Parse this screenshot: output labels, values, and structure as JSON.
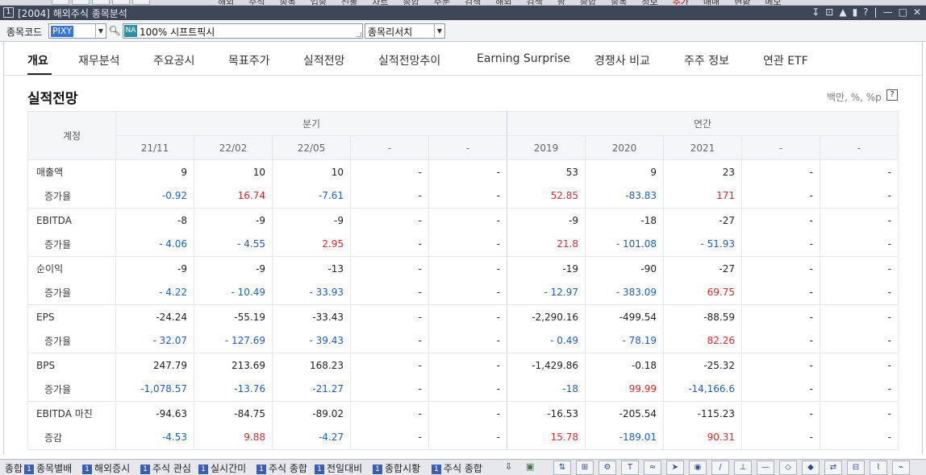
{
  "title_bar": {
    "text": "[2004] 해외주식 종목분석",
    "controls": [
      "↧",
      "⊡",
      "▲",
      "▮",
      "?",
      "|",
      "—",
      "□",
      "✕"
    ]
  },
  "top_menu": [
    "해외",
    "주식",
    "종목",
    "업종",
    "선물",
    "차트",
    "종합",
    "주문",
    "검색",
    "해외",
    "검색",
    "팜",
    "종합",
    "종목",
    "정보",
    "추가",
    "매매",
    "현황",
    "메모"
  ],
  "code_bar": {
    "label": "종목코드",
    "code_value": "PIXY",
    "name_badge": "NA",
    "name_value": "100% 시프트픽시",
    "finder_label": "종목리서치"
  },
  "tabs": [
    "개요",
    "재무분석",
    "주요공시",
    "목표주가",
    "실적전망",
    "실적전망추이",
    "Earning Surprise",
    "경쟁사 비교",
    "주주 정보",
    "연관 ETF"
  ],
  "section": {
    "title": "실적전망",
    "unit": "백만, %, %p",
    "help": "?"
  },
  "table": {
    "account_header": "계정",
    "group_quarterly": "분기",
    "group_annual": "연간",
    "columns": [
      "21/11",
      "22/02",
      "22/05",
      "-",
      "-",
      "2019",
      "2020",
      "2021",
      "-",
      "-"
    ],
    "rows": [
      {
        "label": "매출액",
        "type": "main",
        "values": [
          "9",
          "10",
          "10",
          "-",
          "-",
          "53",
          "9",
          "23",
          "-",
          "-"
        ]
      },
      {
        "label": "증가율",
        "type": "sub",
        "values": [
          "-0.92",
          "16.74",
          "-7.61",
          "-",
          "-",
          "52.85",
          "-83.83",
          "171",
          "-",
          "-"
        ],
        "colors": [
          "neg",
          "pos",
          "neg",
          "",
          "",
          "pos",
          "neg",
          "pos",
          "",
          ""
        ]
      },
      {
        "label": "EBITDA",
        "type": "main",
        "values": [
          "-8",
          "-9",
          "-9",
          "-",
          "-",
          "-9",
          "-18",
          "-27",
          "-",
          "-"
        ]
      },
      {
        "label": "증가율",
        "type": "sub",
        "values": [
          "- 4.06",
          "- 4.55",
          "2.95",
          "-",
          "-",
          "21.8",
          "- 101.08",
          "- 51.93",
          "-",
          "-"
        ],
        "colors": [
          "neg",
          "neg",
          "pos",
          "",
          "",
          "pos",
          "neg",
          "neg",
          "",
          ""
        ]
      },
      {
        "label": "순이익",
        "type": "main",
        "values": [
          "-9",
          "-9",
          "-13",
          "-",
          "-",
          "-19",
          "-90",
          "-27",
          "-",
          "-"
        ]
      },
      {
        "label": "증가율",
        "type": "sub",
        "values": [
          "- 4.22",
          "- 10.49",
          "- 33.93",
          "-",
          "-",
          "- 12.97",
          "- 383.09",
          "69.75",
          "-",
          "-"
        ],
        "colors": [
          "neg",
          "neg",
          "neg",
          "",
          "",
          "neg",
          "neg",
          "pos",
          "",
          ""
        ]
      },
      {
        "label": "EPS",
        "type": "main",
        "values": [
          "-24.24",
          "-55.19",
          "-33.43",
          "-",
          "-",
          "-2,290.16",
          "-499.54",
          "-88.59",
          "-",
          "-"
        ]
      },
      {
        "label": "증가율",
        "type": "sub",
        "values": [
          "- 32.07",
          "- 127.69",
          "- 39.43",
          "-",
          "-",
          "- 0.49",
          "- 78.19",
          "82.26",
          "-",
          "-"
        ],
        "colors": [
          "neg",
          "neg",
          "neg",
          "",
          "",
          "neg",
          "neg",
          "pos",
          "",
          ""
        ]
      },
      {
        "label": "BPS",
        "type": "main",
        "values": [
          "247.79",
          "213.69",
          "168.23",
          "-",
          "-",
          "-1,429.86",
          "-0.18",
          "-25.32",
          "-",
          "-"
        ]
      },
      {
        "label": "증가율",
        "type": "sub",
        "values": [
          "-1,078.57",
          "-13.76",
          "-21.27",
          "-",
          "-",
          "-18",
          "99.99",
          "-14,166.6",
          "-",
          "-"
        ],
        "colors": [
          "neg",
          "neg",
          "neg",
          "",
          "",
          "neg",
          "pos",
          "neg",
          "",
          ""
        ]
      },
      {
        "label": "EBITDA 마진",
        "type": "main",
        "values": [
          "-94.63",
          "-84.75",
          "-89.02",
          "-",
          "-",
          "-16.53",
          "-205.54",
          "-115.23",
          "-",
          "-"
        ]
      },
      {
        "label": "증감",
        "type": "sub",
        "values": [
          "-4.53",
          "9.88",
          "-4.27",
          "-",
          "-",
          "15.78",
          "-189.01",
          "90.31",
          "-",
          "-"
        ],
        "colors": [
          "neg",
          "pos",
          "neg",
          "",
          "",
          "pos",
          "neg",
          "pos",
          "",
          ""
        ]
      }
    ]
  },
  "taskbar": {
    "start_label": "종합",
    "items": [
      {
        "num": "1",
        "label": "종목별배"
      },
      {
        "num": "1",
        "label": "해외증시"
      },
      {
        "num": "1",
        "label": "주식 관심"
      },
      {
        "num": "1",
        "label": "실시간미"
      },
      {
        "num": "1",
        "label": "주식 종합"
      },
      {
        "num": "1",
        "label": "전일대비"
      },
      {
        "num": "1",
        "label": "종합시황"
      },
      {
        "num": "1",
        "label": "주식 종합"
      }
    ],
    "tools": [
      "⇅",
      "⊞",
      "⚙",
      "T",
      "≈",
      "➤",
      "◉",
      "∕",
      "⊥",
      "—",
      "◇",
      "◆",
      "⇄",
      "⊟",
      "⌇",
      "⌁"
    ]
  },
  "colors": {
    "negative": "#1d5fb8",
    "positive": "#d22b2b",
    "title_bar_bg": "#3c4657",
    "header_bg": "#f5f6f8"
  }
}
